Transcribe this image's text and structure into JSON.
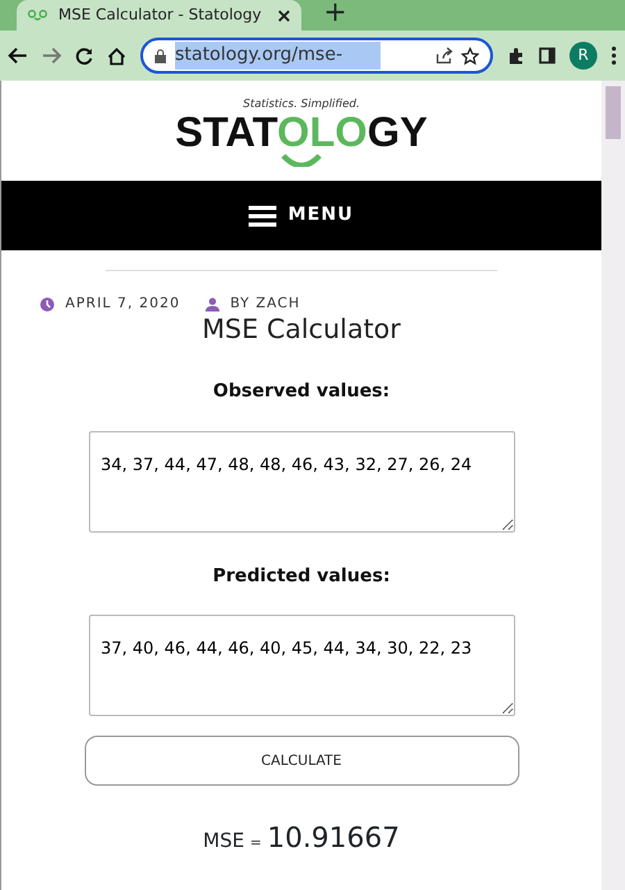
{
  "browser": {
    "tab_title": "MSE Calculator - Statology",
    "new_tab": "+",
    "url": "statology.org/mse-",
    "profile": "R"
  },
  "site": {
    "tagline": "Statistics. Simplified.",
    "logo": [
      {
        "text": "STAT",
        "color": "#111111"
      },
      {
        "text": "OLO",
        "color": "#5cb85c"
      },
      {
        "text": "GY",
        "color": "#111111"
      }
    ],
    "menu": "MENU"
  },
  "post": {
    "date": "APRIL 7, 2020",
    "author": "BY ZACH",
    "title": "MSE Calculator"
  },
  "calculator": {
    "fields": [
      {
        "label": "Observed values:",
        "value": "34, 37, 44, 47, 48, 48, 46, 43, 32, 27, 26, 24"
      },
      {
        "label": "Predicted values:",
        "value": "37, 40, 46, 44, 46, 40, 45, 44, 34, 30, 22, 23"
      }
    ],
    "button": "CALCULATE",
    "result_label": "MSE",
    "result_sign": "=",
    "result_value": "10.91667"
  }
}
